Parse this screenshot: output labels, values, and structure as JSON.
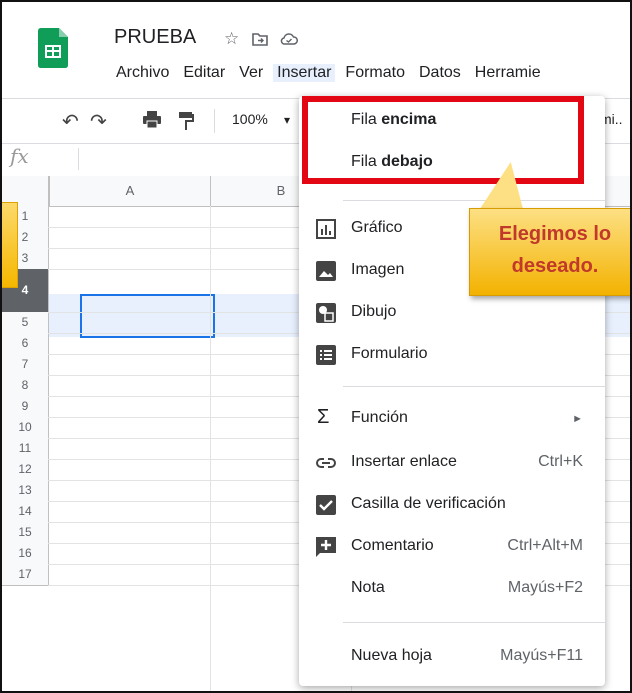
{
  "doc": {
    "title": "PRUEBA"
  },
  "menubar": [
    "Archivo",
    "Editar",
    "Ver",
    "Insertar",
    "Formato",
    "Datos",
    "Herramie"
  ],
  "toolbar": {
    "zoom": "100%",
    "trailing": "mi.."
  },
  "formula_bar": {
    "fx": "fx"
  },
  "columns": [
    "A",
    "B"
  ],
  "rows": [
    "1",
    "2",
    "3",
    "4",
    "5",
    "6",
    "7",
    "8",
    "9",
    "10",
    "11",
    "12",
    "13",
    "14",
    "15",
    "16",
    "17"
  ],
  "menu": {
    "row_above": {
      "prefix": "Fila ",
      "bold": "encima"
    },
    "row_below": {
      "prefix": "Fila ",
      "bold": "debajo"
    },
    "items": [
      {
        "label": "Gráfico",
        "icon": "chart-icon"
      },
      {
        "label": "Imagen",
        "icon": "image-icon"
      },
      {
        "label": "Dibujo",
        "icon": "drawing-icon"
      },
      {
        "label": "Formulario",
        "icon": "form-icon"
      },
      {
        "label": "Función",
        "icon": "sigma-icon",
        "shortcut": "►"
      },
      {
        "label": "Insertar enlace",
        "icon": "link-icon",
        "shortcut": "Ctrl+K"
      },
      {
        "label": "Casilla de verificación",
        "icon": "checkbox-icon"
      },
      {
        "label": "Comentario",
        "icon": "comment-icon",
        "shortcut": "Ctrl+Alt+M"
      },
      {
        "label": "Nota",
        "shortcut": "Mayús+F2"
      },
      {
        "label": "Nueva hoja",
        "shortcut": "Mayús+F11"
      }
    ]
  },
  "callout": {
    "line1": "Elegimos lo",
    "line2": "deseado."
  },
  "colors": {
    "red_box": "#e30613",
    "callout": "#f5b800",
    "callout_text": "#c0392b",
    "selection": "#1a73e8"
  }
}
